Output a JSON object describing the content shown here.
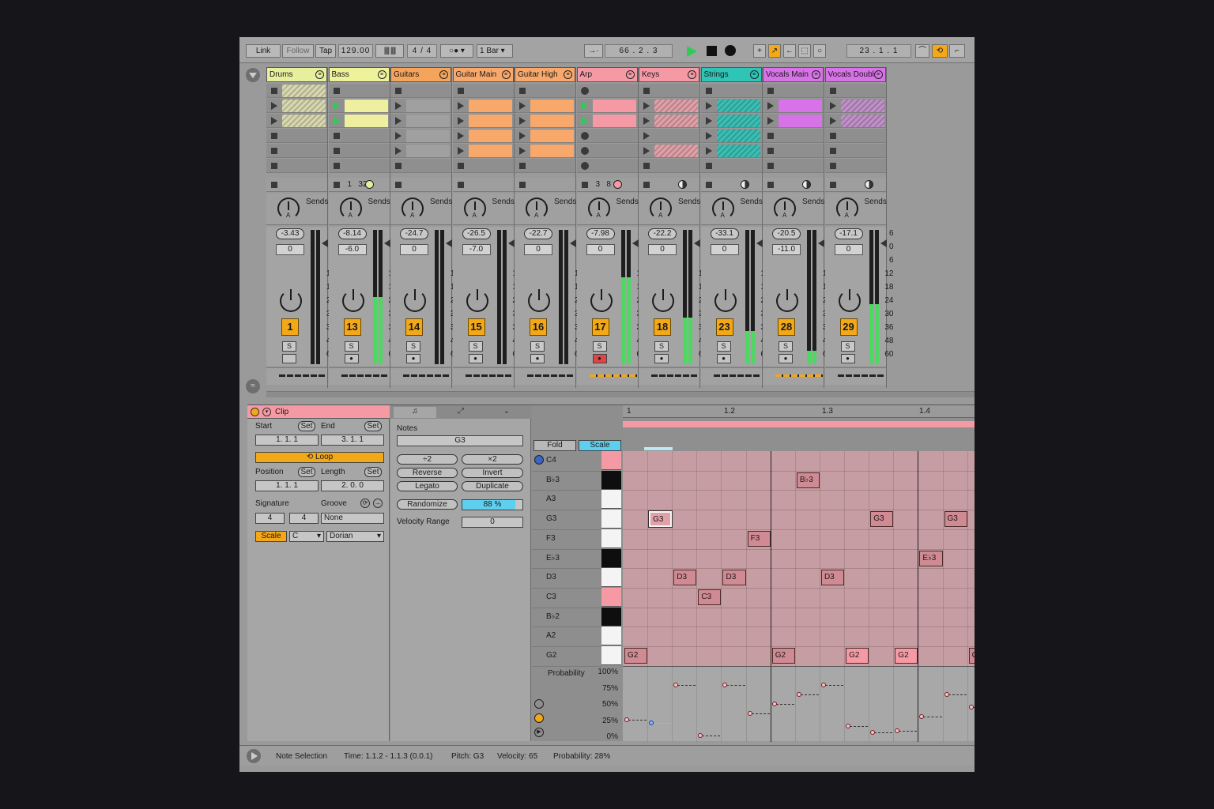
{
  "transport": {
    "link": "Link",
    "follow": "Follow",
    "tap": "Tap",
    "tempo": "129.00",
    "time_sig": "4 / 4",
    "quantize": "1 Bar",
    "position": "66 .  2 .  3",
    "loop_pos": "23 .  1 .  1"
  },
  "tracks": [
    {
      "name": "Drums",
      "color": "#e7ee9c",
      "slots": [
        "sq",
        "pl",
        "pl",
        "sq",
        "sq",
        "sq"
      ],
      "clip_color": "#d8d8b0",
      "clips": [
        0,
        1,
        2
      ],
      "stop": "",
      "vol": "-3.43",
      "pan": "0",
      "num": "1",
      "arm": false,
      "meter": 0
    },
    {
      "name": "Bass",
      "color": "#eef29a",
      "slots": [
        "sq",
        "pl",
        "pl",
        "sq",
        "sq",
        "sq"
      ],
      "clip_color": "#eef0a0",
      "clips": [
        1,
        2
      ],
      "stop": "1   32",
      "vol": "-8.14",
      "pan": "-6.0",
      "num": "13",
      "arm": false,
      "meter": 0.5
    },
    {
      "name": "Guitars",
      "color": "#f4a45b",
      "slots": [
        "sq",
        "pl",
        "pl",
        "pl",
        "pl",
        "sq"
      ],
      "clip_color": "#a0a0a0",
      "clips": [
        1,
        2,
        3,
        4
      ],
      "stop": "",
      "vol": "-24.7",
      "pan": "0",
      "num": "14",
      "arm": false,
      "meter": 0
    },
    {
      "name": "Guitar Main",
      "color": "#f7a86a",
      "slots": [
        "sq",
        "pl",
        "pl",
        "pl",
        "pl",
        "sq"
      ],
      "clip_color": "#f7a86a",
      "clips": [
        1,
        2,
        3,
        4
      ],
      "stop": "",
      "vol": "-26.5",
      "pan": "-7.0",
      "num": "15",
      "arm": false,
      "meter": 0
    },
    {
      "name": "Guitar High",
      "color": "#f7a86a",
      "slots": [
        "sq",
        "pl",
        "pl",
        "pl",
        "pl",
        "sq"
      ],
      "clip_color": "#f7a86a",
      "clips": [
        1,
        2,
        3,
        4
      ],
      "stop": "",
      "vol": "-22.7",
      "pan": "0",
      "num": "16",
      "arm": false,
      "meter": 0
    },
    {
      "name": "Arp",
      "color": "#f59aa5",
      "slots": [
        "rec",
        "pl",
        "pl",
        "rec",
        "rec",
        "rec"
      ],
      "clip_color": "#f59aa5",
      "clips": [
        1,
        2
      ],
      "stop": "3   8",
      "vol": "-7.98",
      "pan": "0",
      "num": "17",
      "arm": true,
      "meter": 0.65
    },
    {
      "name": "Keys",
      "color": "#f59aa5",
      "slots": [
        "sq",
        "pl",
        "pl",
        "pl",
        "pl",
        "sq"
      ],
      "clip_color": "#e0a0a8",
      "clips": [
        1,
        2,
        4
      ],
      "stop": "",
      "vol": "-22.2",
      "pan": "0",
      "num": "18",
      "arm": false,
      "meter": 0.35
    },
    {
      "name": "Strings",
      "color": "#2ec4b6",
      "slots": [
        "sq",
        "pl",
        "pl",
        "pl",
        "pl",
        "sq"
      ],
      "clip_color": "#3bbfb4",
      "clips": [
        1,
        2,
        3,
        4
      ],
      "stop": "",
      "vol": "-33.1",
      "pan": "0",
      "num": "23",
      "arm": false,
      "meter": 0.25
    },
    {
      "name": "Vocals Main",
      "color": "#d872e8",
      "slots": [
        "sq",
        "pl",
        "pl",
        "sq",
        "sq",
        "sq"
      ],
      "clip_color": "#d872e8",
      "clips": [
        1,
        2
      ],
      "stop": "",
      "vol": "-20.5",
      "pan": "-11.0",
      "num": "28",
      "arm": false,
      "meter": 0.1
    },
    {
      "name": "Vocals Doubl",
      "color": "#d872e8",
      "slots": [
        "sq",
        "pl",
        "pl",
        "sq",
        "sq",
        "sq"
      ],
      "clip_color": "#c090c8",
      "clips": [
        1,
        2
      ],
      "stop": "",
      "vol": "-17.1",
      "pan": "0",
      "num": "29",
      "arm": false,
      "meter": 0.45
    }
  ],
  "mixer": {
    "sends_label": "Sends",
    "solo": "S",
    "scale": [
      "6",
      "0",
      "6",
      "12",
      "18",
      "24",
      "30",
      "36",
      "48",
      "60"
    ]
  },
  "clip": {
    "title": "Clip",
    "start": "Start",
    "end": "End",
    "set": "Set",
    "start_val": "1.   1.   1",
    "end_val": "3.   1.   1",
    "loop": "Loop",
    "position": "Position",
    "length": "Length",
    "position_val": "1.   1.   1",
    "length_val": "2.   0.   0",
    "signature": "Signature",
    "groove": "Groove",
    "sig_num": "4",
    "sig_den": "4",
    "groove_val": "None",
    "scale": "Scale",
    "root": "C",
    "mode": "Dorian"
  },
  "notes": {
    "title": "Notes",
    "pitch": "G3",
    "half": "÷2",
    "double": "×2",
    "reverse": "Reverse",
    "invert": "Invert",
    "legato": "Legato",
    "duplicate": "Duplicate",
    "randomize": "Randomize",
    "rand_val": "88 %",
    "vel_range": "Velocity Range",
    "vel_val": "0"
  },
  "roll": {
    "fold": "Fold",
    "scale": "Scale",
    "bars": [
      "1",
      "1.2",
      "1.3",
      "1.4"
    ],
    "keys": [
      "C4",
      "B♭3",
      "A3",
      "G3",
      "F3",
      "E♭3",
      "D3",
      "C3",
      "B♭2",
      "A2",
      "G2"
    ],
    "key_colors": [
      "pink",
      "black",
      "white",
      "white",
      "white",
      "black",
      "white",
      "pink",
      "black",
      "white",
      "white"
    ],
    "notes": [
      {
        "label": "G3",
        "row": 3,
        "start": 1,
        "sel": true
      },
      {
        "label": "D3",
        "row": 6,
        "start": 2
      },
      {
        "label": "C3",
        "row": 7,
        "start": 3
      },
      {
        "label": "D3",
        "row": 6,
        "start": 4
      },
      {
        "label": "F3",
        "row": 4,
        "start": 5
      },
      {
        "label": "B♭3",
        "row": 1,
        "start": 7
      },
      {
        "label": "D3",
        "row": 6,
        "start": 8
      },
      {
        "label": "G3",
        "row": 3,
        "start": 10
      },
      {
        "label": "E♭3",
        "row": 5,
        "start": 12
      },
      {
        "label": "G3",
        "row": 3,
        "start": 13
      },
      {
        "label": "G2",
        "row": 10,
        "start": 0
      },
      {
        "label": "G2",
        "row": 10,
        "start": 6
      },
      {
        "label": "G2",
        "row": 10,
        "start": 9
      },
      {
        "label": "G2",
        "row": 10,
        "start": 11
      },
      {
        "label": "G",
        "row": 10,
        "start": 14
      }
    ],
    "prob_label": "Probability",
    "prob_ticks": [
      "100%",
      "75%",
      "50%",
      "25%",
      "0%"
    ],
    "prob": [
      0.3,
      0.25,
      0.85,
      0.05,
      0.85,
      0.4,
      0.55,
      0.7,
      0.85,
      0.2,
      0.1,
      0.12,
      0.35,
      0.7,
      0.5
    ]
  },
  "status": {
    "text": "Note Selection",
    "time": "Time: 1.1.2 - 1.1.3 (0.0.1)",
    "pitch": "Pitch: G3",
    "velocity": "Velocity: 65",
    "probability": "Probability: 28%"
  }
}
